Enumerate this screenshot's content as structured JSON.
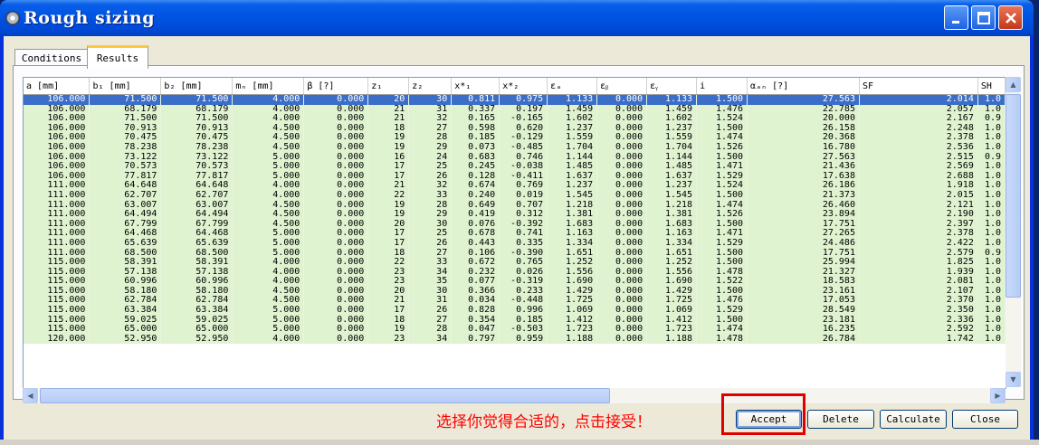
{
  "window": {
    "title": "Rough sizing",
    "minimize_icon": "minimize-icon",
    "maximize_icon": "maximize-icon",
    "close_icon": "close-icon",
    "app_icon": "gear-icon"
  },
  "tabs": [
    {
      "label": "Conditions",
      "active": false
    },
    {
      "label": "Results",
      "active": true
    }
  ],
  "table": {
    "columns": [
      "a [mm]",
      "b₁ [mm]",
      "b₂ [mm]",
      "mₙ [mm]",
      "β [?]",
      "z₁",
      "z₂",
      "x*₁",
      "x*₂",
      "εₐ",
      "εᵦ",
      "εᵧ",
      "i",
      "αₐₙ [?]",
      "SF",
      "SH"
    ],
    "rows": [
      [
        "106.000",
        "71.500",
        "71.500",
        "4.000",
        "0.000",
        "20",
        "30",
        "0.811",
        "0.975",
        "1.133",
        "0.000",
        "1.133",
        "1.500",
        "27.563",
        "2.014",
        "1.0"
      ],
      [
        "106.000",
        "68.179",
        "68.179",
        "4.000",
        "0.000",
        "21",
        "31",
        "0.337",
        "0.197",
        "1.459",
        "0.000",
        "1.459",
        "1.476",
        "22.785",
        "2.057",
        "1.0"
      ],
      [
        "106.000",
        "71.500",
        "71.500",
        "4.000",
        "0.000",
        "21",
        "32",
        "0.165",
        "-0.165",
        "1.602",
        "0.000",
        "1.602",
        "1.524",
        "20.000",
        "2.167",
        "0.9"
      ],
      [
        "106.000",
        "70.913",
        "70.913",
        "4.500",
        "0.000",
        "18",
        "27",
        "0.598",
        "0.620",
        "1.237",
        "0.000",
        "1.237",
        "1.500",
        "26.158",
        "2.248",
        "1.0"
      ],
      [
        "106.000",
        "70.475",
        "70.475",
        "4.500",
        "0.000",
        "19",
        "28",
        "0.185",
        "-0.129",
        "1.559",
        "0.000",
        "1.559",
        "1.474",
        "20.368",
        "2.378",
        "1.0"
      ],
      [
        "106.000",
        "78.238",
        "78.238",
        "4.500",
        "0.000",
        "19",
        "29",
        "0.073",
        "-0.485",
        "1.704",
        "0.000",
        "1.704",
        "1.526",
        "16.780",
        "2.536",
        "1.0"
      ],
      [
        "106.000",
        "73.122",
        "73.122",
        "5.000",
        "0.000",
        "16",
        "24",
        "0.683",
        "0.746",
        "1.144",
        "0.000",
        "1.144",
        "1.500",
        "27.563",
        "2.515",
        "0.9"
      ],
      [
        "106.000",
        "70.573",
        "70.573",
        "5.000",
        "0.000",
        "17",
        "25",
        "0.245",
        "-0.038",
        "1.485",
        "0.000",
        "1.485",
        "1.471",
        "21.436",
        "2.569",
        "1.0"
      ],
      [
        "106.000",
        "77.817",
        "77.817",
        "5.000",
        "0.000",
        "17",
        "26",
        "0.128",
        "-0.411",
        "1.637",
        "0.000",
        "1.637",
        "1.529",
        "17.638",
        "2.688",
        "1.0"
      ],
      [
        "111.000",
        "64.648",
        "64.648",
        "4.000",
        "0.000",
        "21",
        "32",
        "0.674",
        "0.769",
        "1.237",
        "0.000",
        "1.237",
        "1.524",
        "26.186",
        "1.918",
        "1.0"
      ],
      [
        "111.000",
        "62.707",
        "62.707",
        "4.000",
        "0.000",
        "22",
        "33",
        "0.240",
        "0.019",
        "1.545",
        "0.000",
        "1.545",
        "1.500",
        "21.373",
        "2.015",
        "1.0"
      ],
      [
        "111.000",
        "63.007",
        "63.007",
        "4.500",
        "0.000",
        "19",
        "28",
        "0.649",
        "0.707",
        "1.218",
        "0.000",
        "1.218",
        "1.474",
        "26.460",
        "2.121",
        "1.0"
      ],
      [
        "111.000",
        "64.494",
        "64.494",
        "4.500",
        "0.000",
        "19",
        "29",
        "0.419",
        "0.312",
        "1.381",
        "0.000",
        "1.381",
        "1.526",
        "23.894",
        "2.190",
        "1.0"
      ],
      [
        "111.000",
        "67.799",
        "67.799",
        "4.500",
        "0.000",
        "20",
        "30",
        "0.076",
        "-0.392",
        "1.683",
        "0.000",
        "1.683",
        "1.500",
        "17.751",
        "2.397",
        "1.0"
      ],
      [
        "111.000",
        "64.468",
        "64.468",
        "5.000",
        "0.000",
        "17",
        "25",
        "0.678",
        "0.741",
        "1.163",
        "0.000",
        "1.163",
        "1.471",
        "27.265",
        "2.378",
        "1.0"
      ],
      [
        "111.000",
        "65.639",
        "65.639",
        "5.000",
        "0.000",
        "17",
        "26",
        "0.443",
        "0.335",
        "1.334",
        "0.000",
        "1.334",
        "1.529",
        "24.486",
        "2.422",
        "1.0"
      ],
      [
        "111.000",
        "68.500",
        "68.500",
        "5.000",
        "0.000",
        "18",
        "27",
        "0.106",
        "-0.390",
        "1.651",
        "0.000",
        "1.651",
        "1.500",
        "17.751",
        "2.579",
        "0.9"
      ],
      [
        "115.000",
        "58.391",
        "58.391",
        "4.000",
        "0.000",
        "22",
        "33",
        "0.672",
        "0.765",
        "1.252",
        "0.000",
        "1.252",
        "1.500",
        "25.994",
        "1.825",
        "1.0"
      ],
      [
        "115.000",
        "57.138",
        "57.138",
        "4.000",
        "0.000",
        "23",
        "34",
        "0.232",
        "0.026",
        "1.556",
        "0.000",
        "1.556",
        "1.478",
        "21.327",
        "1.939",
        "1.0"
      ],
      [
        "115.000",
        "60.996",
        "60.996",
        "4.000",
        "0.000",
        "23",
        "35",
        "0.077",
        "-0.319",
        "1.690",
        "0.000",
        "1.690",
        "1.522",
        "18.583",
        "2.081",
        "1.0"
      ],
      [
        "115.000",
        "58.180",
        "58.180",
        "4.500",
        "0.000",
        "20",
        "30",
        "0.366",
        "0.233",
        "1.429",
        "0.000",
        "1.429",
        "1.500",
        "23.161",
        "2.107",
        "1.0"
      ],
      [
        "115.000",
        "62.784",
        "62.784",
        "4.500",
        "0.000",
        "21",
        "31",
        "0.034",
        "-0.448",
        "1.725",
        "0.000",
        "1.725",
        "1.476",
        "17.053",
        "2.370",
        "1.0"
      ],
      [
        "115.000",
        "63.384",
        "63.384",
        "5.000",
        "0.000",
        "17",
        "26",
        "0.828",
        "0.996",
        "1.069",
        "0.000",
        "1.069",
        "1.529",
        "28.549",
        "2.350",
        "1.0"
      ],
      [
        "115.000",
        "59.025",
        "59.025",
        "5.000",
        "0.000",
        "18",
        "27",
        "0.354",
        "0.185",
        "1.412",
        "0.000",
        "1.412",
        "1.500",
        "23.181",
        "2.336",
        "1.0"
      ],
      [
        "115.000",
        "65.000",
        "65.000",
        "5.000",
        "0.000",
        "19",
        "28",
        "0.047",
        "-0.503",
        "1.723",
        "0.000",
        "1.723",
        "1.474",
        "16.235",
        "2.592",
        "1.0"
      ],
      [
        "120.000",
        "52.950",
        "52.950",
        "4.000",
        "0.000",
        "23",
        "34",
        "0.797",
        "0.959",
        "1.188",
        "0.000",
        "1.188",
        "1.478",
        "26.784",
        "1.742",
        "1.0"
      ]
    ],
    "selected_row": 0
  },
  "hint_text": "选择你觉得合适的，点击接受！",
  "buttons": {
    "accept": "Accept",
    "delete": "Delete",
    "calculate": "Calculate",
    "close": "Close"
  },
  "colors": {
    "row_bg": "#dff3d0",
    "selected_bg": "#3a6ec8",
    "hint": "#ff0000",
    "highlight_box": "#e00000"
  }
}
